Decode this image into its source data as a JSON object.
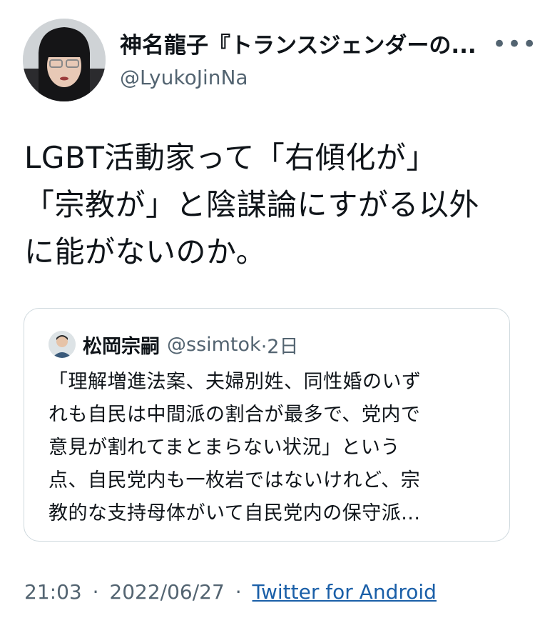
{
  "author": {
    "display_name": "神名龍子『トランスジェンダーの...",
    "handle": "@LyukoJinNa",
    "more_icon": "more-icon"
  },
  "tweet": {
    "lines": [
      "LGBT活動家って「右傾化が」",
      "「宗教が」と陰謀論にすがる以外",
      "に能がないのか。"
    ]
  },
  "quote": {
    "name": "松岡宗嗣",
    "handle": "@ssimtok",
    "time": "·2日",
    "lines": [
      "「理解増進法案、夫婦別姓、同性婚のいず",
      "れも自民は中間派の割合が最多で、党内で",
      "意見が割れてまとまらない状況」という",
      "点、自民党内も一枚岩ではないけれど、宗",
      "教的な支持母体がいて自民党内の保守派..."
    ]
  },
  "meta": {
    "time": "21:03",
    "separator": "·",
    "date": "2022/06/27",
    "source": "Twitter for Android"
  },
  "colors": {
    "text": "#0f1419",
    "secondary": "#536471",
    "border": "#cfd9de",
    "link": "#1a5fa8"
  }
}
